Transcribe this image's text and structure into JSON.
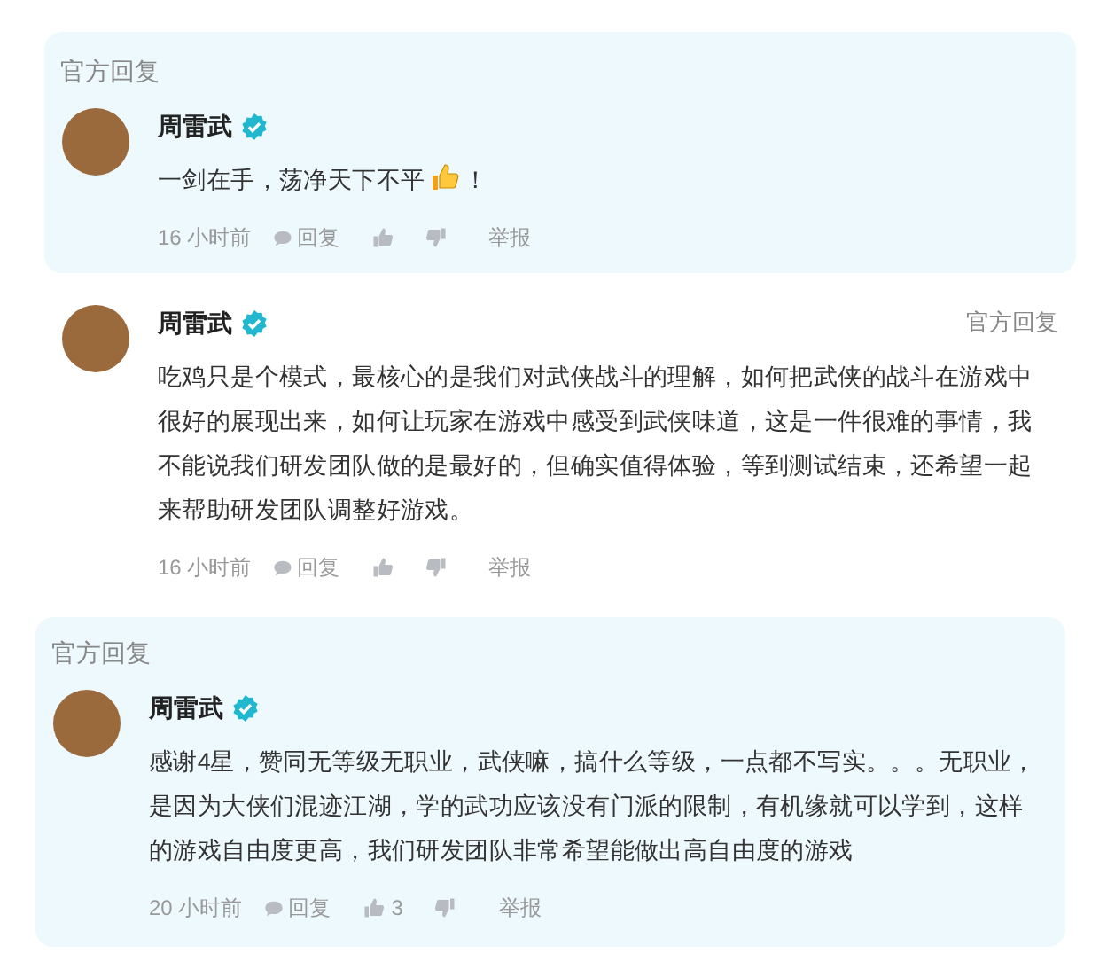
{
  "replies": [
    {
      "kind": "card",
      "badge": "官方回复",
      "author": "周雷武",
      "verified": true,
      "text": "一剑在手，荡净天下不平",
      "emoji_after": true,
      "text_end": "！",
      "time": "16 小时前",
      "reply_label": "回复",
      "report_label": "举报"
    },
    {
      "kind": "plain",
      "badge": "官方回复",
      "author": "周雷武",
      "verified": true,
      "text": "吃鸡只是个模式，最核心的是我们对武侠战斗的理解，如何把武侠的战斗在游戏中很好的展现出来，如何让玩家在游戏中感受到武侠味道，这是一件很难的事情，我不能说我们研发团队做的是最好的，但确实值得体验，等到测试结束，还希望一起来帮助研发团队调整好游戏。",
      "time": "16 小时前",
      "reply_label": "回复",
      "report_label": "举报"
    },
    {
      "kind": "card",
      "badge": "官方回复",
      "author": "周雷武",
      "verified": true,
      "text": "感谢4星，赞同无等级无职业，武侠嘛，搞什么等级，一点都不写实。。。无职业，是因为大侠们混迹江湖，学的武功应该没有门派的限制，有机缘就可以学到，这样的游戏自由度更高，我们研发团队非常希望能做出高自由度的游戏",
      "time": "20 小时前",
      "reply_label": "回复",
      "likes": "3",
      "report_label": "举报"
    }
  ]
}
